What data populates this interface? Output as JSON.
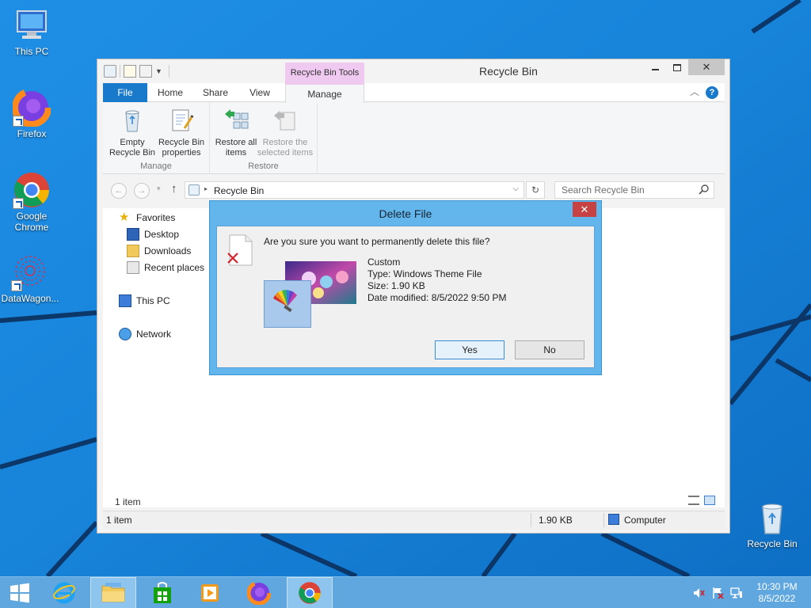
{
  "desktop": {
    "icons": [
      {
        "label": "This PC"
      },
      {
        "label": "Firefox"
      },
      {
        "label": "Google Chrome"
      },
      {
        "label": "DataWagon..."
      },
      {
        "label": "Recycle Bin"
      }
    ]
  },
  "window": {
    "title": "Recycle Bin",
    "context_tab_title": "Recycle Bin Tools",
    "tabs": [
      "File",
      "Home",
      "Share",
      "View",
      "Manage"
    ],
    "ribbon": {
      "groups": [
        {
          "label": "Manage",
          "buttons": [
            "Empty Recycle Bin",
            "Recycle Bin properties"
          ]
        },
        {
          "label": "Restore",
          "buttons": [
            "Restore all items",
            "Restore the selected items"
          ]
        }
      ]
    },
    "address": {
      "path": "Recycle Bin"
    },
    "search": {
      "placeholder": "Search Recycle Bin"
    },
    "nav": {
      "favorites": "Favorites",
      "desktop": "Desktop",
      "downloads": "Downloads",
      "recent": "Recent places",
      "this_pc": "This PC",
      "network": "Network"
    },
    "content": {
      "item_count": "1 item"
    },
    "statusbar": {
      "items": "1 item",
      "size": "1.90 KB",
      "location": "Computer"
    }
  },
  "dialog": {
    "title": "Delete File",
    "question": "Are you sure you want to permanently delete this file?",
    "file_name": "Custom",
    "type": "Type: Windows Theme File",
    "size": "Size: 1.90 KB",
    "date_modified": "Date modified: 8/5/2022 9:50 PM",
    "yes": "Yes",
    "no": "No"
  },
  "taskbar": {
    "time": "10:30 PM",
    "date": "8/5/2022"
  },
  "colors": {
    "desktop_bg": "#1a7fd6",
    "accent": "#1979ca",
    "dialog_frame": "#62b6ec",
    "context_tab": "#f0c9f0",
    "close_red": "#c74343"
  }
}
